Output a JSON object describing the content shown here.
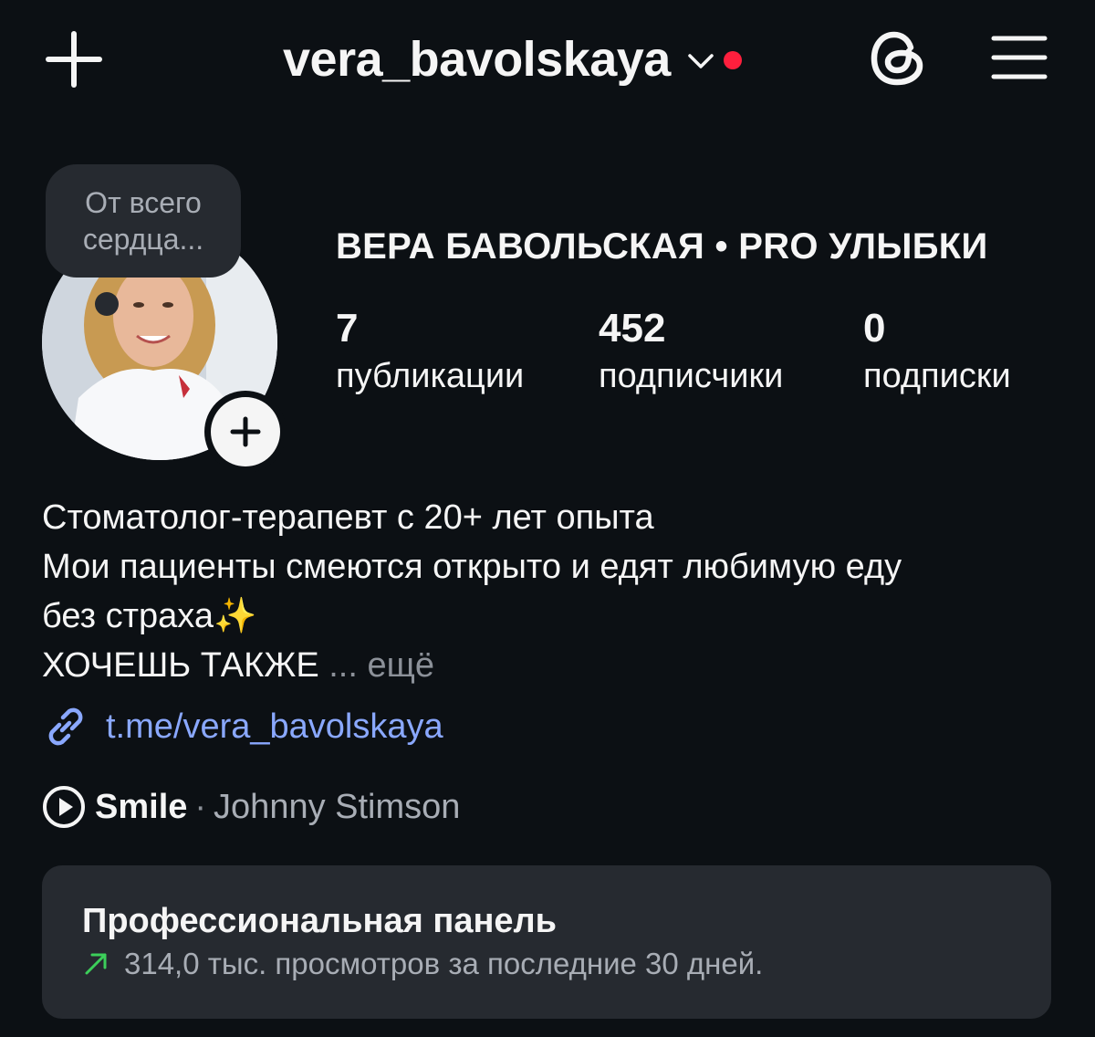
{
  "header": {
    "username": "vera_bavolskaya",
    "icons": [
      "plus-icon",
      "chevron-down-icon",
      "threads-icon",
      "menu-icon"
    ],
    "notification_dot_color": "#ff1f3d"
  },
  "profile": {
    "note_line1": "От всего",
    "note_line2": "сердца...",
    "full_name": "ВЕРА БАВОЛЬСКАЯ • PRO УЛЫБКИ",
    "stats": [
      {
        "value": "7",
        "label": "публикации"
      },
      {
        "value": "452",
        "label": "подписчики"
      },
      {
        "value": "0",
        "label": "подписки"
      }
    ]
  },
  "bio": {
    "line1": "Стоматолог-терапевт с 20+ лет опыта",
    "line2": "Мои пациенты смеются открыто и едят любимую еду",
    "line3": "без страха✨",
    "line4": "ХОЧЕШЬ ТАКЖЕ",
    "more": "... ещё",
    "link": "t.me/vera_bavolskaya",
    "link_color": "#8aa8ff"
  },
  "music": {
    "title": "Smile",
    "separator": "·",
    "artist": "Johnny Stimson"
  },
  "pro_dashboard": {
    "title": "Профессиональная панель",
    "subtitle": "314,0 тыс. просмотров за последние 30 дней.",
    "trend_color": "#3ccf5a"
  }
}
